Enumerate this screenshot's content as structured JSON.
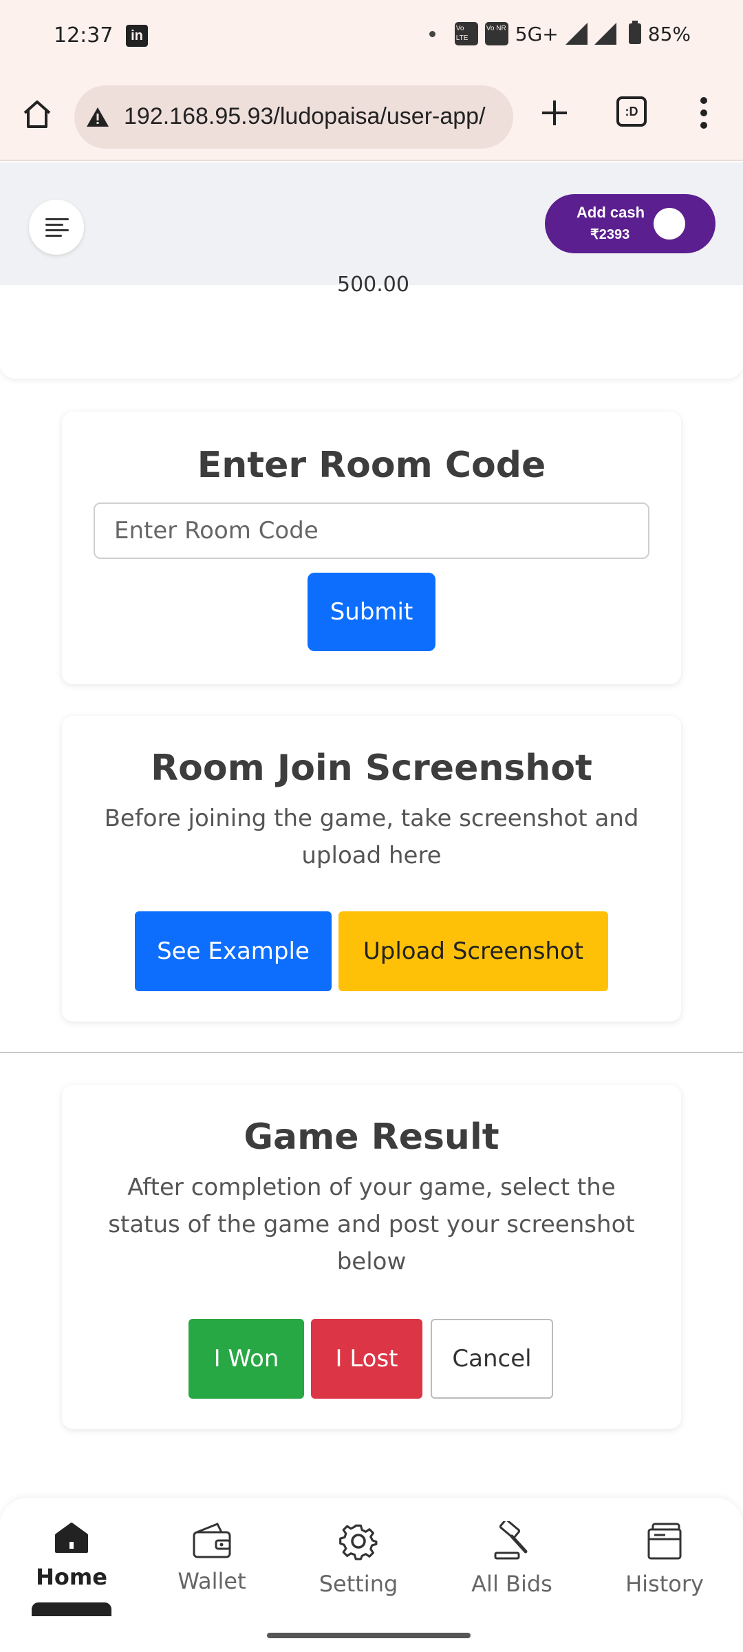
{
  "status_bar": {
    "time": "12:37",
    "linkedin_icon": "in",
    "network": "5G+",
    "volte1": "Vo LTE",
    "volte2": "Vo NR",
    "battery": "85%"
  },
  "browser": {
    "url": "192.168.95.93/ludopaisa/user-app/",
    "tabs_icon": ":D"
  },
  "header": {
    "add_cash_label": "Add cash",
    "balance": "₹2393"
  },
  "top_card": {
    "amount_partial": "500.00"
  },
  "room_code": {
    "title": "Enter Room Code",
    "placeholder": "Enter Room Code",
    "submit_label": "Submit"
  },
  "room_join": {
    "title": "Room Join Screenshot",
    "description": "Before joining the game, take screenshot and upload here",
    "see_example_label": "See Example",
    "upload_label": "Upload Screenshot"
  },
  "game_result": {
    "title": "Game Result",
    "description": "After completion of your game, select the status of the game and post your screenshot below",
    "won_label": "I Won",
    "lost_label": "I Lost",
    "cancel_label": "Cancel"
  },
  "bottom_nav": {
    "items": [
      {
        "label": "Home",
        "icon": "home-icon",
        "active": true
      },
      {
        "label": "Wallet",
        "icon": "wallet-icon"
      },
      {
        "label": "Setting",
        "icon": "gear-icon"
      },
      {
        "label": "All Bids",
        "icon": "gavel-icon"
      },
      {
        "label": "History",
        "icon": "history-icon"
      }
    ]
  },
  "colors": {
    "primary": "#0d6efd",
    "warning": "#ffc107",
    "success": "#28a745",
    "danger": "#dc3545",
    "brand_purple": "#5b1f8f"
  }
}
